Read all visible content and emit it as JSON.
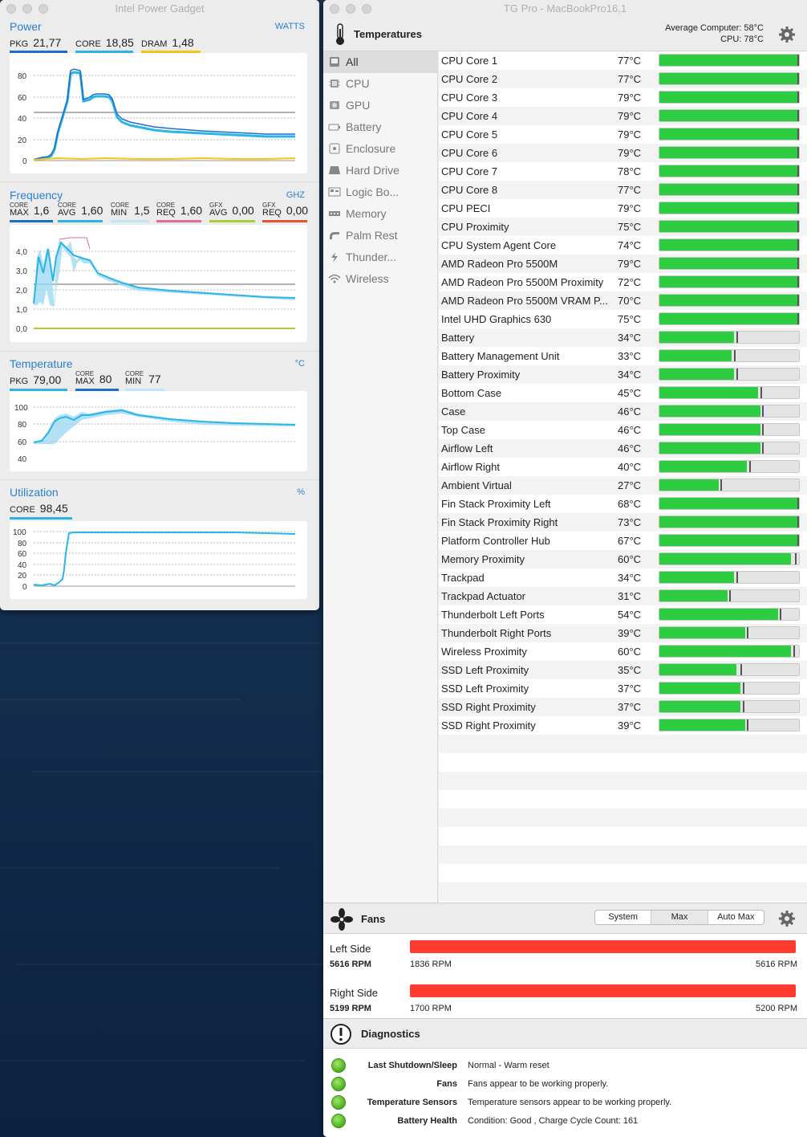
{
  "ipg": {
    "title": "Intel Power Gadget",
    "power": {
      "label": "Power",
      "unit": "WATTS",
      "metrics": [
        {
          "label": "PKG",
          "value": "21,77",
          "color": "#1a6fc9"
        },
        {
          "label": "CORE",
          "value": "18,85",
          "color": "#2ab4e8"
        },
        {
          "label": "DRAM",
          "value": "1,48",
          "color": "#f5c518"
        }
      ],
      "yticks": [
        "80",
        "60",
        "40",
        "20",
        "0"
      ]
    },
    "frequency": {
      "label": "Frequency",
      "unit": "GHZ",
      "metrics": [
        {
          "top": "CORE",
          "bottom": "MAX",
          "value": "1,6",
          "color": "#1a6fc9"
        },
        {
          "top": "CORE",
          "bottom": "AVG",
          "value": "1,60",
          "color": "#2ab4e8"
        },
        {
          "top": "CORE",
          "bottom": "MIN",
          "value": "1,5",
          "color": "#bde6f7"
        },
        {
          "top": "CORE",
          "bottom": "REQ",
          "value": "1,60",
          "color": "#e76a8c"
        },
        {
          "top": "GFX",
          "bottom": "AVG",
          "value": "0,00",
          "color": "#a8cf3a"
        },
        {
          "top": "GFX",
          "bottom": "REQ",
          "value": "0,00",
          "color": "#e4552e"
        }
      ],
      "yticks": [
        "4,0",
        "3,0",
        "2,0",
        "1,0",
        "0,0"
      ]
    },
    "temperature": {
      "label": "Temperature",
      "unit": "°C",
      "metrics": [
        {
          "label": "PKG",
          "value": "79,00",
          "color": "#2ab4e8"
        },
        {
          "top": "CORE",
          "bottom": "MAX",
          "value": "80",
          "color": "#1a6fc9"
        },
        {
          "top": "CORE",
          "bottom": "MIN",
          "value": "77",
          "color": "#bde6f7"
        }
      ],
      "yticks": [
        "100",
        "80",
        "60",
        "40"
      ]
    },
    "utilization": {
      "label": "Utilization",
      "unit": "%",
      "metrics": [
        {
          "label": "CORE",
          "value": "98,45",
          "color": "#2ab4e8"
        }
      ],
      "yticks": [
        "100",
        "80",
        "60",
        "40",
        "20",
        "0"
      ]
    }
  },
  "tg": {
    "title": "TG Pro - MacBookPro16,1",
    "header": {
      "title": "Temperatures",
      "avg_label": "Average Computer:",
      "avg_value": "58°C",
      "cpu_label": "CPU:",
      "cpu_value": "78°C"
    },
    "sidebar": [
      {
        "label": "All",
        "icon": "computer-icon",
        "selected": true
      },
      {
        "label": "CPU",
        "icon": "cpu-icon"
      },
      {
        "label": "GPU",
        "icon": "gpu-icon"
      },
      {
        "label": "Battery",
        "icon": "battery-icon"
      },
      {
        "label": "Enclosure",
        "icon": "enclosure-icon"
      },
      {
        "label": "Hard Drive",
        "icon": "hard-drive-icon"
      },
      {
        "label": "Logic Bo...",
        "icon": "logic-board-icon"
      },
      {
        "label": "Memory",
        "icon": "memory-icon"
      },
      {
        "label": "Palm Rest",
        "icon": "palm-rest-icon"
      },
      {
        "label": "Thunder...",
        "icon": "thunderbolt-icon"
      },
      {
        "label": "Wireless",
        "icon": "wireless-icon"
      }
    ],
    "sensors": [
      {
        "name": "CPU Core 1",
        "temp": "77°C",
        "value": 77,
        "max": 85
      },
      {
        "name": "CPU Core 2",
        "temp": "77°C",
        "value": 77,
        "max": 84
      },
      {
        "name": "CPU Core 3",
        "temp": "79°C",
        "value": 79,
        "max": 85
      },
      {
        "name": "CPU Core 4",
        "temp": "79°C",
        "value": 79,
        "max": 87
      },
      {
        "name": "CPU Core 5",
        "temp": "79°C",
        "value": 79,
        "max": 86
      },
      {
        "name": "CPU Core 6",
        "temp": "79°C",
        "value": 79,
        "max": 86
      },
      {
        "name": "CPU Core 7",
        "temp": "78°C",
        "value": 78,
        "max": 84
      },
      {
        "name": "CPU Core 8",
        "temp": "77°C",
        "value": 77,
        "max": 85
      },
      {
        "name": "CPU PECI",
        "temp": "79°C",
        "value": 79,
        "max": 86
      },
      {
        "name": "CPU Proximity",
        "temp": "75°C",
        "value": 75,
        "max": 80
      },
      {
        "name": "CPU System Agent Core",
        "temp": "74°C",
        "value": 74,
        "max": 81
      },
      {
        "name": "AMD Radeon Pro 5500M",
        "temp": "79°C",
        "value": 79,
        "max": 81
      },
      {
        "name": "AMD Radeon Pro 5500M Proximity",
        "temp": "72°C",
        "value": 72,
        "max": 74
      },
      {
        "name": "AMD Radeon Pro 5500M VRAM P...",
        "temp": "70°C",
        "value": 70,
        "max": 71
      },
      {
        "name": "Intel UHD Graphics 630",
        "temp": "75°C",
        "value": 75,
        "max": 79
      },
      {
        "name": "Battery",
        "temp": "34°C",
        "value": 34,
        "max": 35
      },
      {
        "name": "Battery Management Unit",
        "temp": "33°C",
        "value": 33,
        "max": 34
      },
      {
        "name": "Battery Proximity",
        "temp": "34°C",
        "value": 34,
        "max": 35
      },
      {
        "name": "Bottom Case",
        "temp": "45°C",
        "value": 45,
        "max": 46
      },
      {
        "name": "Case",
        "temp": "46°C",
        "value": 46,
        "max": 47
      },
      {
        "name": "Top Case",
        "temp": "46°C",
        "value": 46,
        "max": 47
      },
      {
        "name": "Airflow Left",
        "temp": "46°C",
        "value": 46,
        "max": 47
      },
      {
        "name": "Airflow Right",
        "temp": "40°C",
        "value": 40,
        "max": 41
      },
      {
        "name": "Ambient Virtual",
        "temp": "27°C",
        "value": 27,
        "max": 28
      },
      {
        "name": "Fin Stack Proximity Left",
        "temp": "68°C",
        "value": 68,
        "max": 72
      },
      {
        "name": "Fin Stack Proximity Right",
        "temp": "73°C",
        "value": 73,
        "max": 74
      },
      {
        "name": "Platform Controller Hub",
        "temp": "67°C",
        "value": 67,
        "max": 77
      },
      {
        "name": "Memory Proximity",
        "temp": "60°C",
        "value": 60,
        "max": 62
      },
      {
        "name": "Trackpad",
        "temp": "34°C",
        "value": 34,
        "max": 35
      },
      {
        "name": "Trackpad Actuator",
        "temp": "31°C",
        "value": 31,
        "max": 32
      },
      {
        "name": "Thunderbolt Left Ports",
        "temp": "54°C",
        "value": 54,
        "max": 55
      },
      {
        "name": "Thunderbolt Right Ports",
        "temp": "39°C",
        "value": 39,
        "max": 40
      },
      {
        "name": "Wireless Proximity",
        "temp": "60°C",
        "value": 60,
        "max": 61
      },
      {
        "name": "SSD Left Proximity",
        "temp": "35°C",
        "value": 35,
        "max": 37
      },
      {
        "name": "SSD Left Proximity",
        "temp": "37°C",
        "value": 37,
        "max": 38
      },
      {
        "name": "SSD Right Proximity",
        "temp": "37°C",
        "value": 37,
        "max": 38
      },
      {
        "name": "SSD Right Proximity",
        "temp": "39°C",
        "value": 39,
        "max": 40
      }
    ],
    "fans": {
      "title": "Fans",
      "modes": [
        "System",
        "Max",
        "Auto Max"
      ],
      "selected_mode": "Max",
      "items": [
        {
          "name": "Left Side",
          "rpm": "5616 RPM",
          "min": "1836 RPM",
          "max": "5616 RPM"
        },
        {
          "name": "Right Side",
          "rpm": "5199 RPM",
          "min": "1700 RPM",
          "max": "5200 RPM"
        }
      ]
    },
    "diagnostics": {
      "title": "Diagnostics",
      "items": [
        {
          "label": "Last Shutdown/Sleep",
          "value": "Normal - Warm reset"
        },
        {
          "label": "Fans",
          "value": "Fans appear to be working properly."
        },
        {
          "label": "Temperature Sensors",
          "value": "Temperature sensors appear to be working properly."
        },
        {
          "label": "Battery Health",
          "value": "Condition: Good , Charge Cycle Count: 161"
        }
      ]
    }
  }
}
